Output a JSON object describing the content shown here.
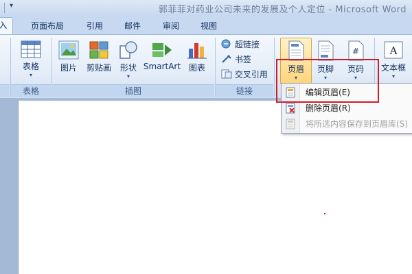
{
  "window": {
    "title": "郭菲菲对药业公司未来的发展及个人定位 - Microsoft Word"
  },
  "tabs": [
    {
      "label": "插入",
      "visible_text": "i入",
      "active": true
    },
    {
      "label": "页面布局"
    },
    {
      "label": "引用"
    },
    {
      "label": "邮件"
    },
    {
      "label": "审阅"
    },
    {
      "label": "视图"
    }
  ],
  "ribbon": {
    "groups": {
      "tables": {
        "label": "表格",
        "buttons": [
          {
            "label": "表格",
            "icon": "table-icon"
          }
        ]
      },
      "illustrations": {
        "label": "插图",
        "buttons": [
          {
            "label": "图片",
            "icon": "picture-icon"
          },
          {
            "label": "剪贴画",
            "icon": "clipart-icon"
          },
          {
            "label": "形状",
            "icon": "shapes-icon"
          },
          {
            "label": "SmartArt",
            "icon": "smartart-icon"
          },
          {
            "label": "图表",
            "icon": "chart-icon"
          }
        ]
      },
      "links": {
        "label": "链接",
        "buttons": [
          {
            "label": "超链接",
            "icon": "hyperlink-icon"
          },
          {
            "label": "书签",
            "icon": "bookmark-icon"
          },
          {
            "label": "交叉引用",
            "icon": "crossref-icon"
          }
        ]
      },
      "header_footer": {
        "buttons": [
          {
            "label": "页眉",
            "icon": "header-icon"
          },
          {
            "label": "页脚",
            "icon": "footer-icon"
          },
          {
            "label": "页码",
            "icon": "pagenumber-icon"
          }
        ]
      },
      "text": {
        "buttons": [
          {
            "label": "文本框",
            "icon": "textbox-icon"
          }
        ]
      }
    }
  },
  "header_menu": {
    "items": [
      {
        "label": "编辑页眉",
        "shortcut": "(E)",
        "enabled": true,
        "icon": "edit-header-icon"
      },
      {
        "label": "删除页眉",
        "shortcut": "(R)",
        "enabled": true,
        "icon": "delete-header-icon"
      },
      {
        "label": "将所选内容保存到页眉库",
        "shortcut": "(S)",
        "enabled": false,
        "icon": "save-to-gallery-icon"
      }
    ]
  },
  "colors": {
    "highlight_box": "#d21a2a",
    "ribbon_bg": "#e4edf8",
    "tab_bar": "#c7d9f0"
  }
}
